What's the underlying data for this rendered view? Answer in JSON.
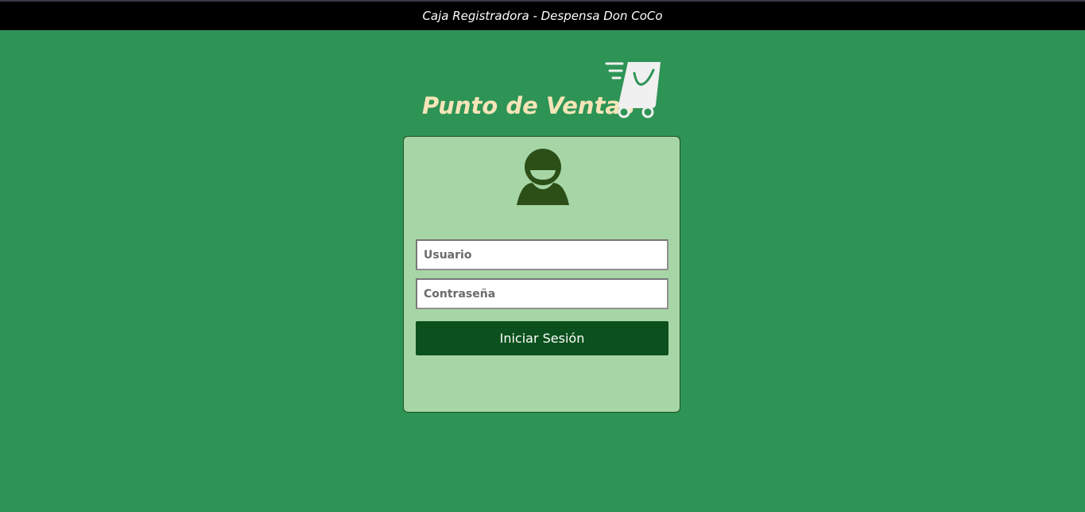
{
  "window": {
    "title": "Caja Registradora - Despensa Don CoCo"
  },
  "brand": {
    "title": "Punto de Ventas",
    "icon": "shopping-cart-icon"
  },
  "login": {
    "avatar_icon": "user-icon",
    "username_placeholder": "Usuario",
    "username_value": "",
    "password_placeholder": "Contraseña",
    "password_value": "",
    "submit_label": "Iniciar Sesión"
  },
  "colors": {
    "background": "#2e9456",
    "titlebar": "#000000",
    "brand_text": "#f6e5b8",
    "card": "#a7d6a6",
    "button": "#0c511d",
    "user_icon": "#2b4f17",
    "cart_icon": "#f0f0f0"
  }
}
